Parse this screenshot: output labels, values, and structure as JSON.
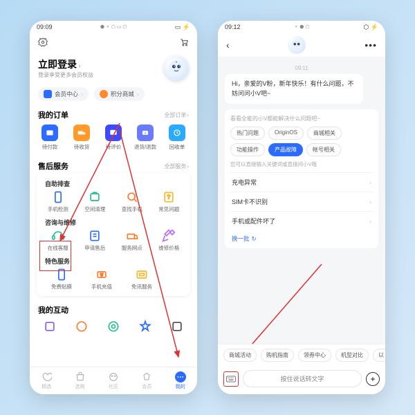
{
  "phoneA": {
    "status": {
      "time": "09:09",
      "icons": "⬢ ⚬ ⬡ ▭ ⬡",
      "right": "▭ ⚡"
    },
    "login": {
      "title": "立即登录",
      "sub": "登录享受更多会员权益"
    },
    "pills": {
      "member": {
        "label": "会员中心",
        "color": "#2b6cff"
      },
      "points": {
        "label": "积分商城",
        "color": "#ff8a2b"
      }
    },
    "orders": {
      "title": "我的订单",
      "more": "全部订单",
      "items": [
        {
          "label": "待付款",
          "color": "#2b6cff"
        },
        {
          "label": "待收货",
          "color": "#ff9a2b"
        },
        {
          "label": "待评价",
          "color": "#3f4aff"
        },
        {
          "label": "退货/退款",
          "color": "#6a7bff"
        },
        {
          "label": "回收单",
          "color": "#2baaff"
        }
      ]
    },
    "aftersale": {
      "title": "售后服务",
      "more": "全部服务",
      "sub1": {
        "title": "自助排查",
        "items": [
          {
            "label": "手机检测",
            "color": "#2b6cff"
          },
          {
            "label": "空间清理",
            "color": "#1fbf8f"
          },
          {
            "label": "查找手机",
            "color": "#ff7a2b"
          },
          {
            "label": "常见问题",
            "color": "#ffb42b"
          }
        ]
      },
      "sub2": {
        "title": "咨询与维修",
        "items": [
          {
            "label": "在线客服",
            "color": "#1fbf8f"
          },
          {
            "label": "申请售后",
            "color": "#2b6cff"
          },
          {
            "label": "服务网点",
            "color": "#ff7a2b"
          },
          {
            "label": "维修价格",
            "color": "#b46cff"
          }
        ]
      },
      "sub3": {
        "title": "特色服务",
        "items": [
          {
            "label": "免费贴膜",
            "color": "#2b6cff"
          },
          {
            "label": "手机充值",
            "color": "#ff7a2b"
          },
          {
            "label": "免讯服务",
            "color": "#ffb42b"
          }
        ]
      }
    },
    "interact": {
      "title": "我的互动"
    },
    "tabs": [
      {
        "label": "精选"
      },
      {
        "label": "选购"
      },
      {
        "label": "社区"
      },
      {
        "label": "会员"
      },
      {
        "label": "我的"
      }
    ]
  },
  "phoneB": {
    "status": {
      "time": "09:12",
      "icons": "⚬ ⬢ ⬡",
      "right": "⬡ ⚡"
    },
    "chat": {
      "time": "09:11",
      "greeting": "Hi，亲爱的V粉，新年快乐！有什么问题，不妨问问小V吧~",
      "faqTitle": "看看全能的小V都能解决什么问题吧~",
      "chips": [
        "热门问题",
        "OriginOS",
        "商城相关",
        "功能操作",
        "产品故障",
        "帐号相关"
      ],
      "hint": "您可以直接输入关键词或直接问小V哦",
      "items": [
        "充电异常",
        "SIM卡不识别",
        "手机或配件坏了"
      ],
      "refresh": "换一批"
    },
    "quick": [
      "商城活动",
      "购机指南",
      "领券中心",
      "机型对比",
      "以"
    ],
    "voice": "按住说话转文字"
  }
}
